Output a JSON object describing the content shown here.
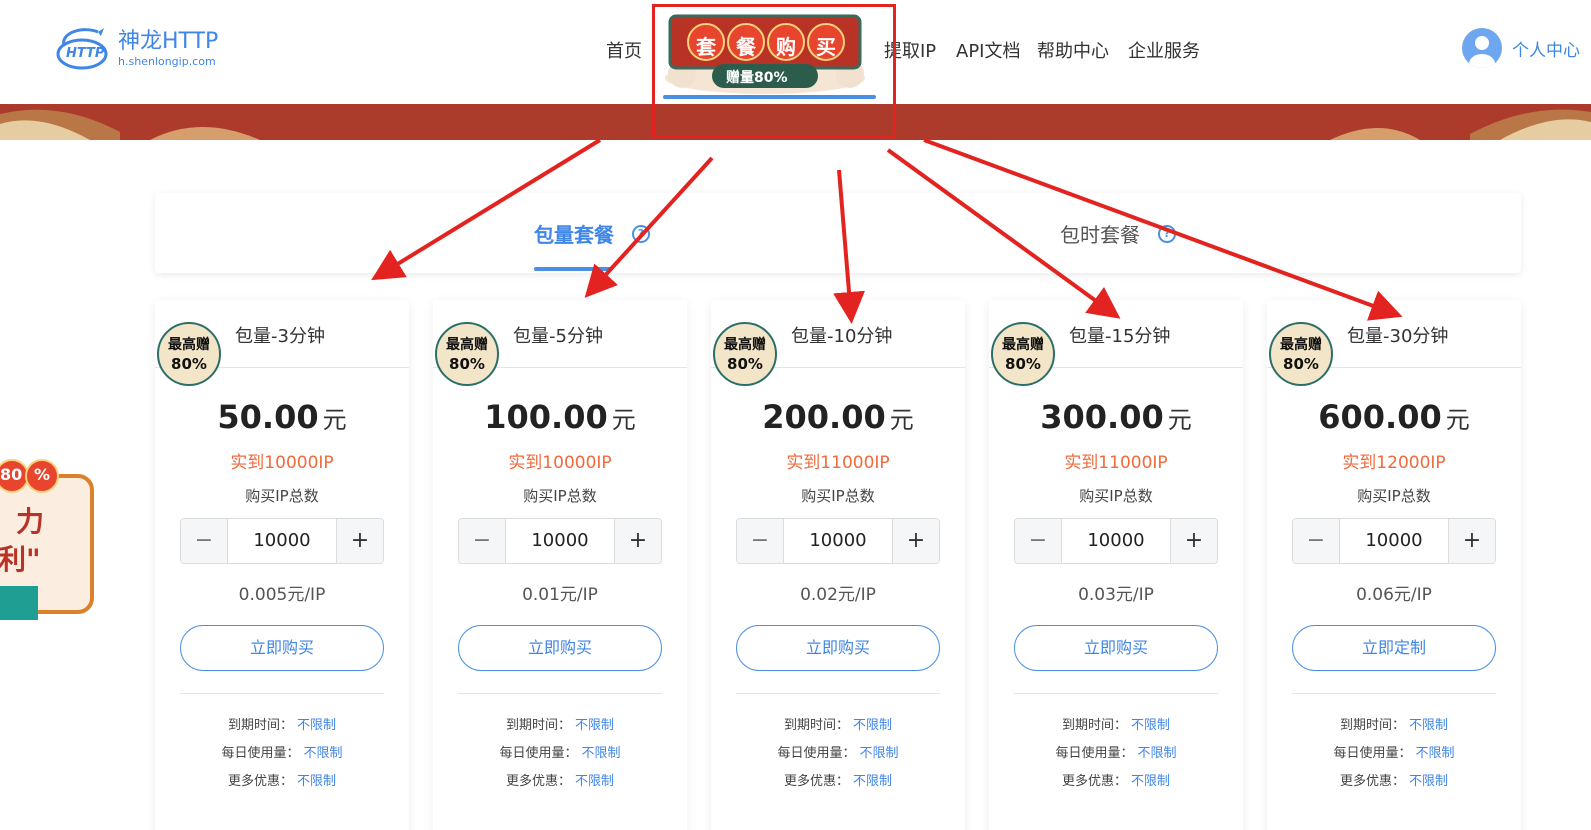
{
  "header": {
    "logo_name": "神龙HTTP",
    "logo_url": "h.shenlongip.com",
    "logo_mark_text": "HTTP",
    "nav": [
      {
        "label": "首页"
      },
      {
        "label": "提取IP"
      },
      {
        "label": "API文档"
      },
      {
        "label": "帮助中心"
      },
      {
        "label": "企业服务"
      }
    ],
    "promo": {
      "chars": [
        "套",
        "餐",
        "购",
        "买"
      ],
      "sub": "赠量80%"
    },
    "user_label": "个人中心"
  },
  "tabs": [
    {
      "label": "包量套餐",
      "active": true
    },
    {
      "label": "包时套餐",
      "active": false
    }
  ],
  "badge": {
    "line1": "最高赠",
    "line2": "80%"
  },
  "cards": [
    {
      "title": "包量-3分钟",
      "price": "50.00",
      "unit": "元",
      "actual": "实到10000IP",
      "ip_label": "购买IP总数",
      "qty": "10000",
      "unit_price": "0.005元/IP",
      "button": "立即购买"
    },
    {
      "title": "包量-5分钟",
      "price": "100.00",
      "unit": "元",
      "actual": "实到10000IP",
      "ip_label": "购买IP总数",
      "qty": "10000",
      "unit_price": "0.01元/IP",
      "button": "立即购买"
    },
    {
      "title": "包量-10分钟",
      "price": "200.00",
      "unit": "元",
      "actual": "实到11000IP",
      "ip_label": "购买IP总数",
      "qty": "10000",
      "unit_price": "0.02元/IP",
      "button": "立即购买"
    },
    {
      "title": "包量-15分钟",
      "price": "300.00",
      "unit": "元",
      "actual": "实到11000IP",
      "ip_label": "购买IP总数",
      "qty": "10000",
      "unit_price": "0.03元/IP",
      "button": "立即购买"
    },
    {
      "title": "包量-30分钟",
      "price": "600.00",
      "unit": "元",
      "actual": "实到12000IP",
      "ip_label": "购买IP总数",
      "qty": "10000",
      "unit_price": "0.06元/IP",
      "button": "立即定制"
    }
  ],
  "info": {
    "expire_label": "到期时间：",
    "daily_label": "每日使用量：",
    "more_label": "更多优惠：",
    "value": "不限制"
  },
  "float_ad": {
    "pct_num": "80",
    "pct_sym": "%",
    "line1": "力",
    "line2": "利\""
  },
  "colors": {
    "accent": "#3f86e6",
    "banner": "#ad3b2c",
    "highlight": "#e3231f",
    "price_actual": "#f06a3c"
  },
  "icons": {
    "tab_info": "info-circle-icon",
    "minus": "minus-icon",
    "plus": "plus-icon",
    "avatar": "user-avatar-icon"
  }
}
